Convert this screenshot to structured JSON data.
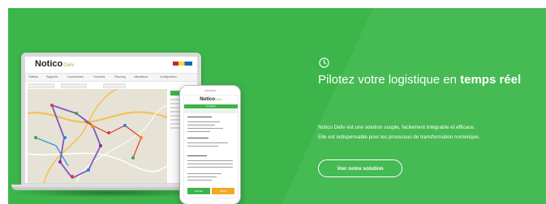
{
  "hero": {
    "bg_color": "#3cb64a",
    "icon": "clock-icon",
    "headline_regular": "Pilotez votre logistique en ",
    "headline_bold": "temps réel",
    "paragraph_line1": "Notico Deliv est une solution souple, facilement intégrable et efficace.",
    "paragraph_line2": "Elle est indispensable pour les processus de transformation numérique.",
    "cta_label": "Voir notre solution"
  },
  "laptop_app": {
    "logo_main": "Notico",
    "logo_accent": "Deliv",
    "nav": [
      "Tableau",
      "Rapports",
      "Commandes",
      "Tournées",
      "Planning",
      "Utilisateurs",
      "Configuration"
    ]
  },
  "phone_app": {
    "logo_main": "Notico",
    "logo_accent": "Deliv",
    "header": "Livraison",
    "button_left": "Annuler",
    "button_right": "Valider"
  }
}
